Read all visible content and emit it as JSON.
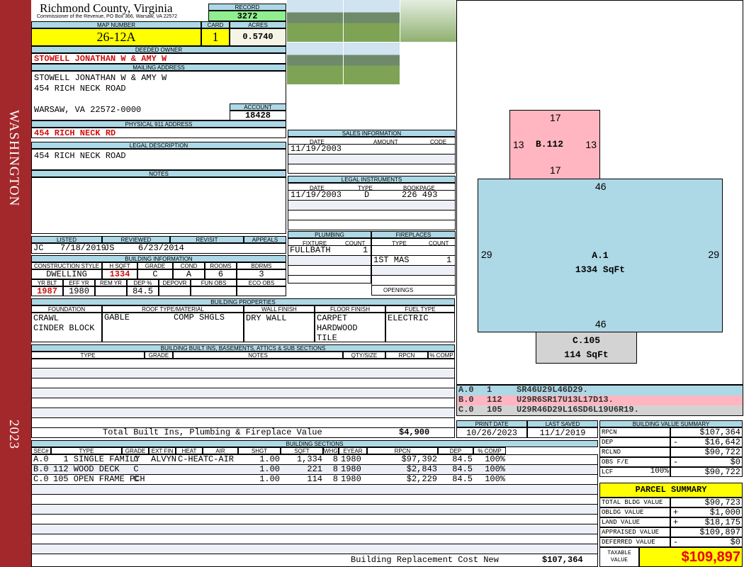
{
  "side": {
    "district": "WASHINGTON",
    "year": "2023"
  },
  "header": {
    "title": "Richmond County, Virginia",
    "subtitle": "Commissioner of the Revenue, PO Box 366, Warsaw, VA 22572",
    "record_label": "RECORD",
    "record": "3272",
    "map_label": "MAP NUMBER",
    "map": "26-12A",
    "card_label": "CARD",
    "card": "1",
    "acres_label": "ACRES",
    "acres": "0.5740"
  },
  "owner": {
    "label": "DEEDED OWNER",
    "value": "STOWELL JONATHAN W & AMY W"
  },
  "mailing": {
    "label": "MAILING ADDRESS",
    "line1": "STOWELL JONATHAN W & AMY W",
    "line2": "454 RICH NECK ROAD",
    "line3": "WARSAW, VA 22572-0000",
    "account_label": "ACCOUNT",
    "account": "18428"
  },
  "physical": {
    "label": "PHYSICAL 911 ADDRESS",
    "value": "454 RICH NECK RD"
  },
  "legal": {
    "label": "LEGAL DESCRIPTION",
    "value": "454 RICH NECK ROAD"
  },
  "notes": {
    "label": "NOTES"
  },
  "listing": {
    "listed_label": "LISTED",
    "reviewed_label": "REVIEWED",
    "revisit_label": "REVISIT",
    "appeals_label": "APPEALS",
    "listed_by": "JC",
    "listed_date": "7/18/2019",
    "reviewed_by": "JS",
    "reviewed_date": "6/23/2014"
  },
  "bldg_info": {
    "label": "BUILDING INFORMATION",
    "h": [
      "CONSTRUCTION STYLE",
      "H SQFT",
      "GRADE",
      "COND",
      "ROOMS",
      "BDRMS"
    ],
    "v": [
      "DWELLING",
      "1334",
      "C",
      "A",
      "6",
      "3"
    ],
    "h2": [
      "YR BLT",
      "EFF YR",
      "REM YR",
      "DEP %",
      "DEPOVR",
      "FUN OBS",
      "ECO OBS"
    ],
    "v2": [
      "1987",
      "1980",
      "",
      "84.5",
      "",
      "",
      ""
    ]
  },
  "bldg_props": {
    "label": "BUILDING PROPERTIES",
    "h": [
      "FOUNDATION",
      "ROOF TYPE/MATERIAL",
      "WALL FINISH",
      "FLOOR FINISH",
      "FUEL TYPE"
    ],
    "foundation": [
      "CRAWL",
      "CINDER BLOCK"
    ],
    "roof_type": "GABLE",
    "roof_mat": "COMP SHGLS",
    "wall": "DRY WALL",
    "floor": [
      "CARPET",
      "HARDWOOD",
      "TILE"
    ],
    "fuel": "ELECTRIC"
  },
  "builtins": {
    "label": "BUILDING BUILT INS, BASEMENTS, ATTICS & SUB SECTIONS",
    "h": [
      "TYPE",
      "GRADE",
      "NOTES",
      "QTY/SIZE",
      "RPCN",
      "% COMP"
    ],
    "total_label": "Total Built Ins, Plumbing & Fireplace Value",
    "total": "$4,900"
  },
  "sales": {
    "label": "SALES INFORMATION",
    "h": [
      "DATE",
      "AMOUNT",
      "CODE"
    ],
    "date": "11/19/2003"
  },
  "instruments": {
    "label": "LEGAL INSTRUMENTS",
    "h": [
      "DATE",
      "TYPE",
      "BOOKPAGE"
    ],
    "date": "11/19/2003",
    "type": "D",
    "bookpage": "226 493"
  },
  "plumbing": {
    "label": "PLUMBING",
    "h": [
      "FIXTURE",
      "COUNT"
    ],
    "fixture": "FULLBATH",
    "count": "1"
  },
  "fireplaces": {
    "label": "FIREPLACES",
    "h": [
      "TYPE",
      "COUNT"
    ],
    "type": "1ST MAS",
    "count": "1",
    "openings": "OPENINGS"
  },
  "sketch": {
    "b": {
      "label": "B.112",
      "top": "17",
      "bottom": "17",
      "left": "13",
      "right": "13"
    },
    "a": {
      "label": "A.1",
      "area": "1334 SqFt",
      "top": "46",
      "bottom": "46",
      "left": "29",
      "right": "29"
    },
    "c": {
      "label": "C.105",
      "area": "114 SqFt"
    },
    "legend": [
      {
        "sec": "A.0",
        "code": "1",
        "vec": "SR46U29L46D29.",
        "color": "#add8e6"
      },
      {
        "sec": "B.0",
        "code": "112",
        "vec": "U29R6SR17U13L17D13.",
        "color": "#ffb6c1"
      },
      {
        "sec": "C.0",
        "code": "105",
        "vec": "U29R46D29L16SD6L19U6R19.",
        "color": "#d3d3d3"
      }
    ]
  },
  "dates": {
    "print_label": "PRINT DATE",
    "print": "10/26/2023",
    "saved_label": "LAST SAVED",
    "saved": "11/1/2019"
  },
  "sections": {
    "label": "BUILDING SECTIONS",
    "h": [
      "SEC#",
      "TYPE",
      "GRADE",
      "EXT FIN",
      "HEAT",
      "AIR",
      "SHGT",
      "SQFT",
      "WHGT",
      "EYEAR",
      "RPCN",
      "DEP",
      "% COMP"
    ],
    "rows": [
      [
        "A.0",
        "  1 SINGLE FAMILY",
        "C",
        "ALVYN",
        "C-HEAT",
        "C-AIR",
        "1.00",
        "1,334",
        "8",
        "1980",
        "$97,392",
        "84.5",
        "100%"
      ],
      [
        "B.0",
        "112 WOOD DECK",
        "C",
        "",
        "",
        "",
        "1.00",
        "221",
        "8",
        "1980",
        "$2,843",
        "84.5",
        "100%"
      ],
      [
        "C.0",
        "105 OPEN FRAME PCH",
        "C",
        "",
        "",
        "",
        "1.00",
        "114",
        "8",
        "1980",
        "$2,229",
        "84.5",
        "100%"
      ]
    ],
    "total_label": "Building Replacement Cost New",
    "total": "$107,364"
  },
  "bvs": {
    "label": "BUILDING VALUE SUMMARY",
    "rows": [
      {
        "k": "RPCN",
        "s": "",
        "v": "$107,364"
      },
      {
        "k": "DEP",
        "s": "-",
        "v": "$16,642"
      },
      {
        "k": "RCLND",
        "s": "",
        "v": "$90,722"
      },
      {
        "k": "OBS F/E",
        "s": "-",
        "v": "$0"
      },
      {
        "k": "LCF",
        "p": "100%",
        "s": "",
        "v": "$90,722"
      }
    ]
  },
  "parcel": {
    "label": "PARCEL SUMMARY",
    "rows": [
      {
        "k": "TOTAL BLDG VALUE",
        "s": "",
        "v": "$90,723"
      },
      {
        "k": "OBLDG VALUE",
        "s": "+",
        "v": "$1,000"
      },
      {
        "k": "LAND VALUE",
        "s": "+",
        "v": "$18,175"
      },
      {
        "k": "APPRAISED VALUE",
        "s": "",
        "v": "$109,897"
      },
      {
        "k": "DEFERRED VALUE",
        "s": "-",
        "v": "$0"
      }
    ],
    "taxable_label1": "TAXABLE",
    "taxable_label2": "VALUE",
    "taxable": "$109,897"
  }
}
